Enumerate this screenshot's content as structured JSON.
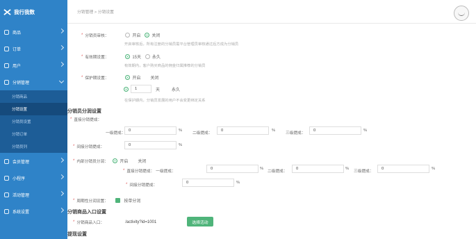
{
  "brand": {
    "name": "我行我数"
  },
  "breadcrumb": "分销管理 > 分销设置",
  "menu": [
    {
      "label": "商品"
    },
    {
      "label": "订单"
    },
    {
      "label": "用户"
    },
    {
      "label": "分销管理"
    },
    {
      "label": "会员管理"
    },
    {
      "label": "小程序"
    },
    {
      "label": "活动管理"
    },
    {
      "label": "系统设置"
    }
  ],
  "submenu": [
    "分销商品",
    "分销设置",
    "分销员设置",
    "分销订单",
    "分销员列"
  ],
  "form": {
    "review": {
      "label": "分销员审核：",
      "opt_on": "开启",
      "opt_off": "关闭",
      "hint": "开启审核后，所有注册的分销员需平台管理员审核通过后方成为分销员"
    },
    "validity": {
      "label": "有效期设置：",
      "opt1": "15天",
      "opt2": "永久",
      "hint": "有效期内，客户购买商品的佣金归属推荐的分销员"
    },
    "protect": {
      "label": "保护期设置：",
      "opt_on": "开启",
      "opt_off": "关闭",
      "days": "1",
      "unit": "天",
      "forever": "永久",
      "hint": "在保护期内，分销员发展的用户不会变更绑定关系"
    },
    "commission": {
      "title": "分销员分润设置",
      "direct": "直接分销提成：",
      "l1": "一级提成：",
      "l2": "二级提成：",
      "l3": "三级提成：",
      "v1": "0",
      "v2": "0",
      "v3": "0",
      "indirect": "间接分销提成：",
      "vi": "0",
      "pct": "%"
    },
    "internal": {
      "label": "内部分销员分润：",
      "opt_on": "开启",
      "opt_off": "关闭",
      "direct": "直接分销提成：",
      "l1": "一级提成：",
      "l2": "二级提成：",
      "l3": "三级提成：",
      "v1": "0",
      "v2": "0",
      "v3": "0",
      "indirect": "间接分销提成：",
      "vi": "0",
      "pct": "%"
    },
    "period": {
      "label": "周期性分润设置：",
      "opt": "按单分润"
    },
    "entry": {
      "title": "分销商品入口设置",
      "label": "分销商品入口：",
      "path": "/activity?id=1001",
      "button": "选择活动"
    },
    "withdraw": {
      "title": "提现设置"
    }
  }
}
